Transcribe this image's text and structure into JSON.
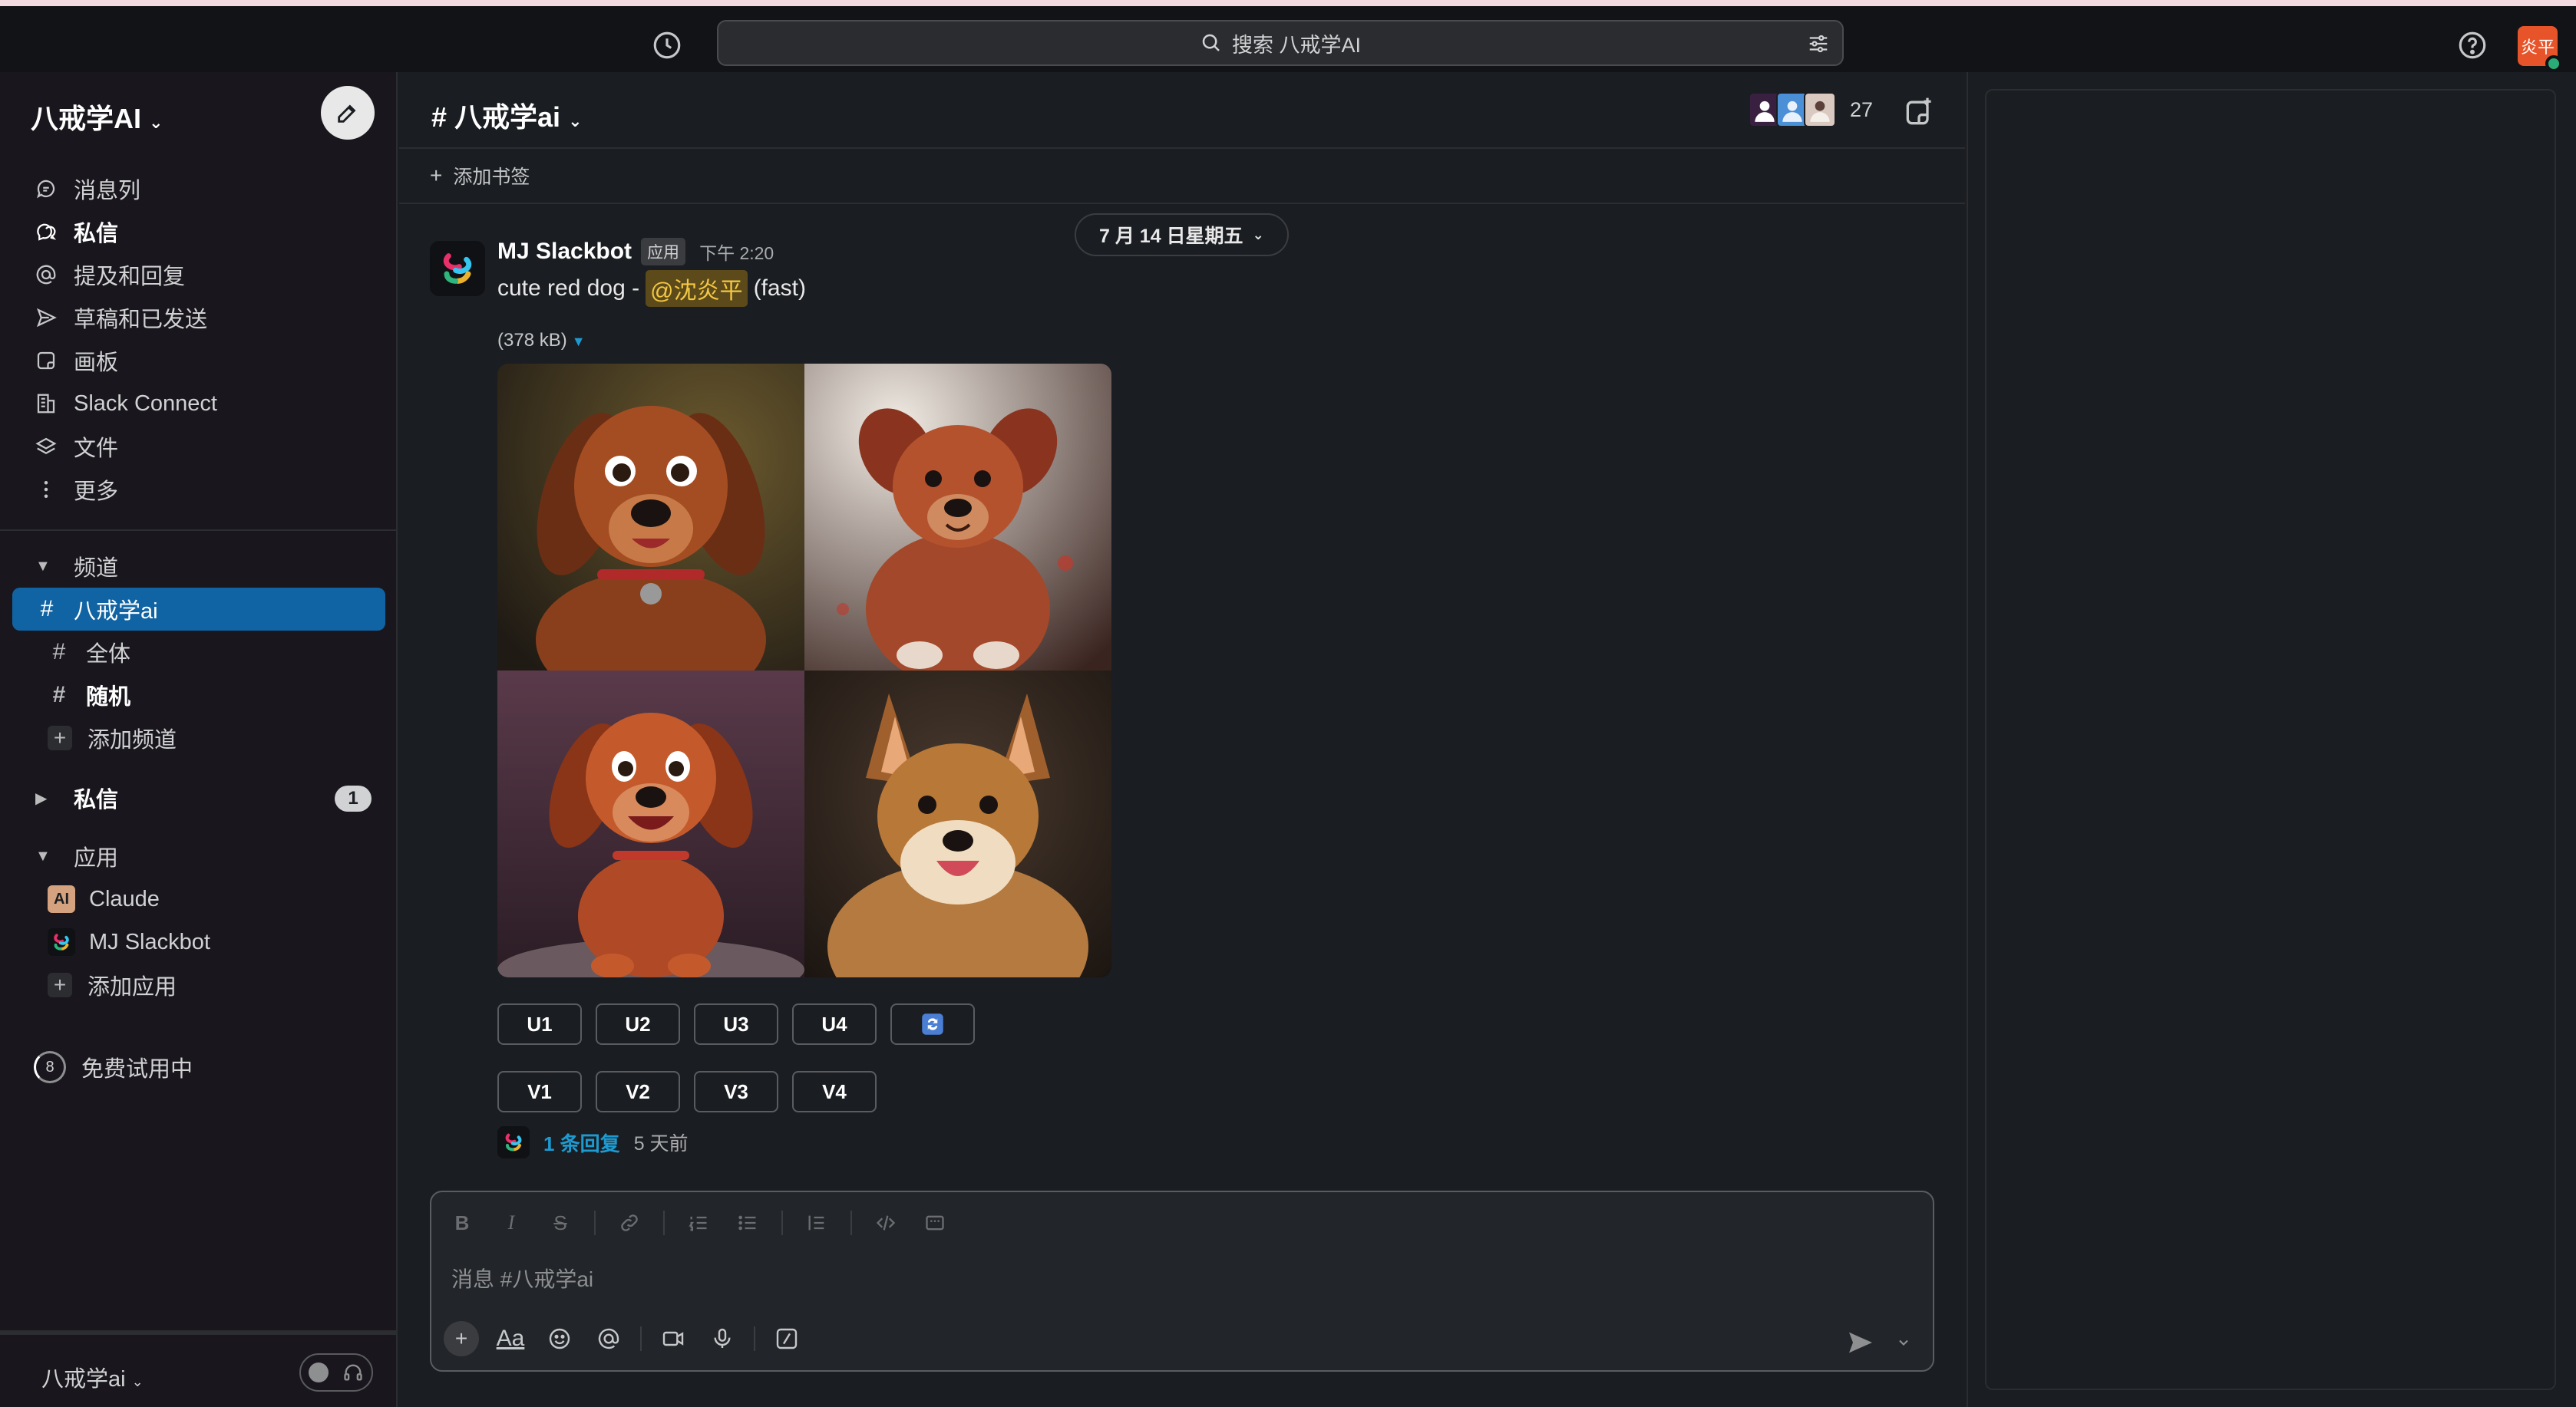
{
  "search": {
    "label": "搜索 八戒学AI"
  },
  "user": {
    "avatar_text": "炎平"
  },
  "workspace": {
    "name": "八戒学AI",
    "switcher_label": "八戒学ai"
  },
  "nav": [
    {
      "label": "消息列",
      "icon": "threads-icon",
      "bold": false
    },
    {
      "label": "私信",
      "icon": "dm-icon",
      "bold": true
    },
    {
      "label": "提及和回复",
      "icon": "at-icon",
      "bold": false
    },
    {
      "label": "草稿和已发送",
      "icon": "send-icon",
      "bold": false
    },
    {
      "label": "画板",
      "icon": "canvas-icon",
      "bold": false
    },
    {
      "label": "Slack Connect",
      "icon": "building-icon",
      "bold": false
    },
    {
      "label": "文件",
      "icon": "layers-icon",
      "bold": false
    },
    {
      "label": "更多",
      "icon": "more-icon",
      "bold": false
    }
  ],
  "channels": {
    "header": "频道",
    "items": [
      {
        "name": "八戒学ai",
        "active": true,
        "bold": false
      },
      {
        "name": "全体",
        "active": false,
        "bold": false
      },
      {
        "name": "随机",
        "active": false,
        "bold": true
      }
    ],
    "add_label": "添加频道"
  },
  "dms": {
    "header": "私信",
    "badge": "1"
  },
  "apps": {
    "header": "应用",
    "items": [
      {
        "name": "Claude",
        "logo_text": "AI",
        "logo_color": "#d4a27f"
      },
      {
        "name": "MJ Slackbot",
        "logo_text": "",
        "logo_color": "#101114"
      }
    ],
    "add_label": "添加应用"
  },
  "trial": {
    "label": "免费试用中",
    "days": "8"
  },
  "channel_header": {
    "title": "# 八戒学ai",
    "member_count": "27",
    "bookmark_label": "添加书签"
  },
  "date_divider": "7 月 14 日星期五",
  "message": {
    "sender": "MJ Slackbot",
    "badge": "应用",
    "time": "下午 2:20",
    "text_before": "cute red dog -",
    "mention": "@沈炎平",
    "text_after": "(fast)",
    "file_size": "(378 kB)",
    "upscale_buttons": [
      "U1",
      "U2",
      "U3",
      "U4"
    ],
    "variation_buttons": [
      "V1",
      "V2",
      "V3",
      "V4"
    ],
    "reply_count": "1 条回复",
    "reply_time": "5 天前"
  },
  "composer": {
    "placeholder": "消息 #八戒学ai"
  },
  "colors": {
    "accent": "#1164a3",
    "link": "#1d9bd1",
    "mention_bg": "#5c4a1a",
    "mention_fg": "#f2c744"
  }
}
